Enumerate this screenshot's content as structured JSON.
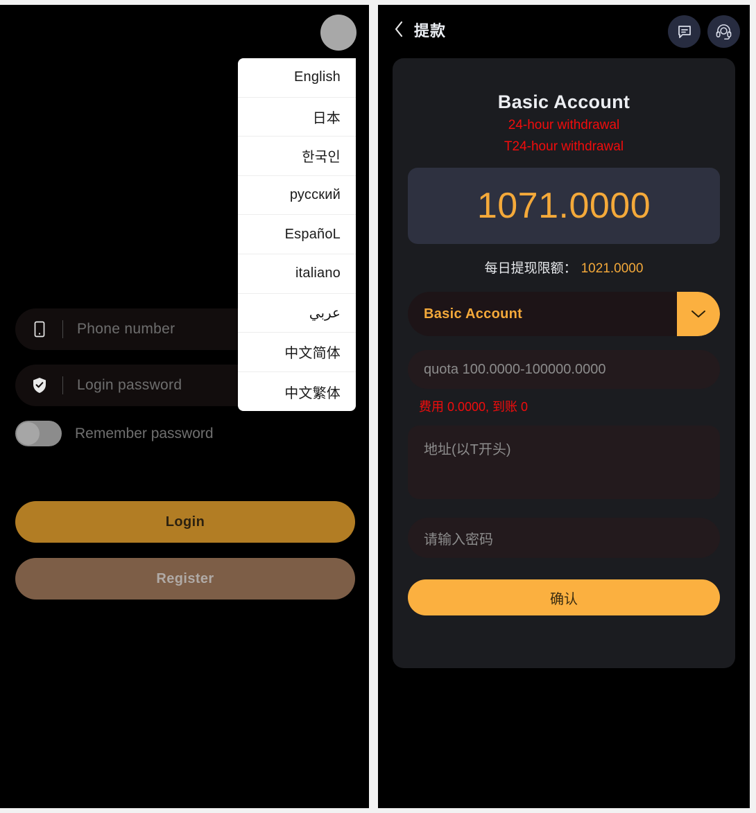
{
  "login": {
    "avatar_icon": "avatar-circle-icon",
    "language_dropdown": {
      "items": [
        {
          "label": "English"
        },
        {
          "label": "日本"
        },
        {
          "label": "한국인"
        },
        {
          "label": "русский"
        },
        {
          "label": "EspañoL"
        },
        {
          "label": "italiano"
        },
        {
          "label": "عربي"
        },
        {
          "label": "中文简体"
        },
        {
          "label": "中文繁体"
        }
      ]
    },
    "phone_field": {
      "icon": "mobile-phone-icon",
      "placeholder": "Phone number",
      "value": ""
    },
    "password_field": {
      "icon": "shield-check-icon",
      "placeholder": "Login password",
      "value": ""
    },
    "remember": {
      "label": "Remember password",
      "state": "off"
    },
    "login_button": "Login",
    "register_button": "Register"
  },
  "withdraw": {
    "header": {
      "back_icon": "chevron-left-icon",
      "title": "提款",
      "message_icon": "chat-bubble-icon",
      "support_icon": "headset-support-icon"
    },
    "account_title": "Basic Account",
    "notes": [
      "24-hour withdrawal",
      "T24-hour withdrawal"
    ],
    "balance": "1071.0000",
    "daily_limit_label": "每日提现限额：",
    "daily_limit_value": "1021.0000",
    "account_select": {
      "selected": "Basic Account",
      "caret_icon": "chevron-down-icon"
    },
    "amount_input": {
      "placeholder": "quota 100.0000-100000.0000",
      "value": ""
    },
    "fee_line": "费用 0.0000, 到账 0",
    "address_input": {
      "placeholder": "地址(以T开头)",
      "value": ""
    },
    "password_input": {
      "placeholder": "请输入密码",
      "value": ""
    },
    "confirm_button": "确认"
  },
  "colors": {
    "accent_orange": "#fbb040",
    "balance_orange": "#f4a93a",
    "alert_red": "#f20c0c",
    "login_gold": "#b27d24",
    "register_brown": "#7d5e47",
    "panel_black": "#000000",
    "card_dark": "#1b1c20",
    "balance_card": "#2e3140"
  }
}
